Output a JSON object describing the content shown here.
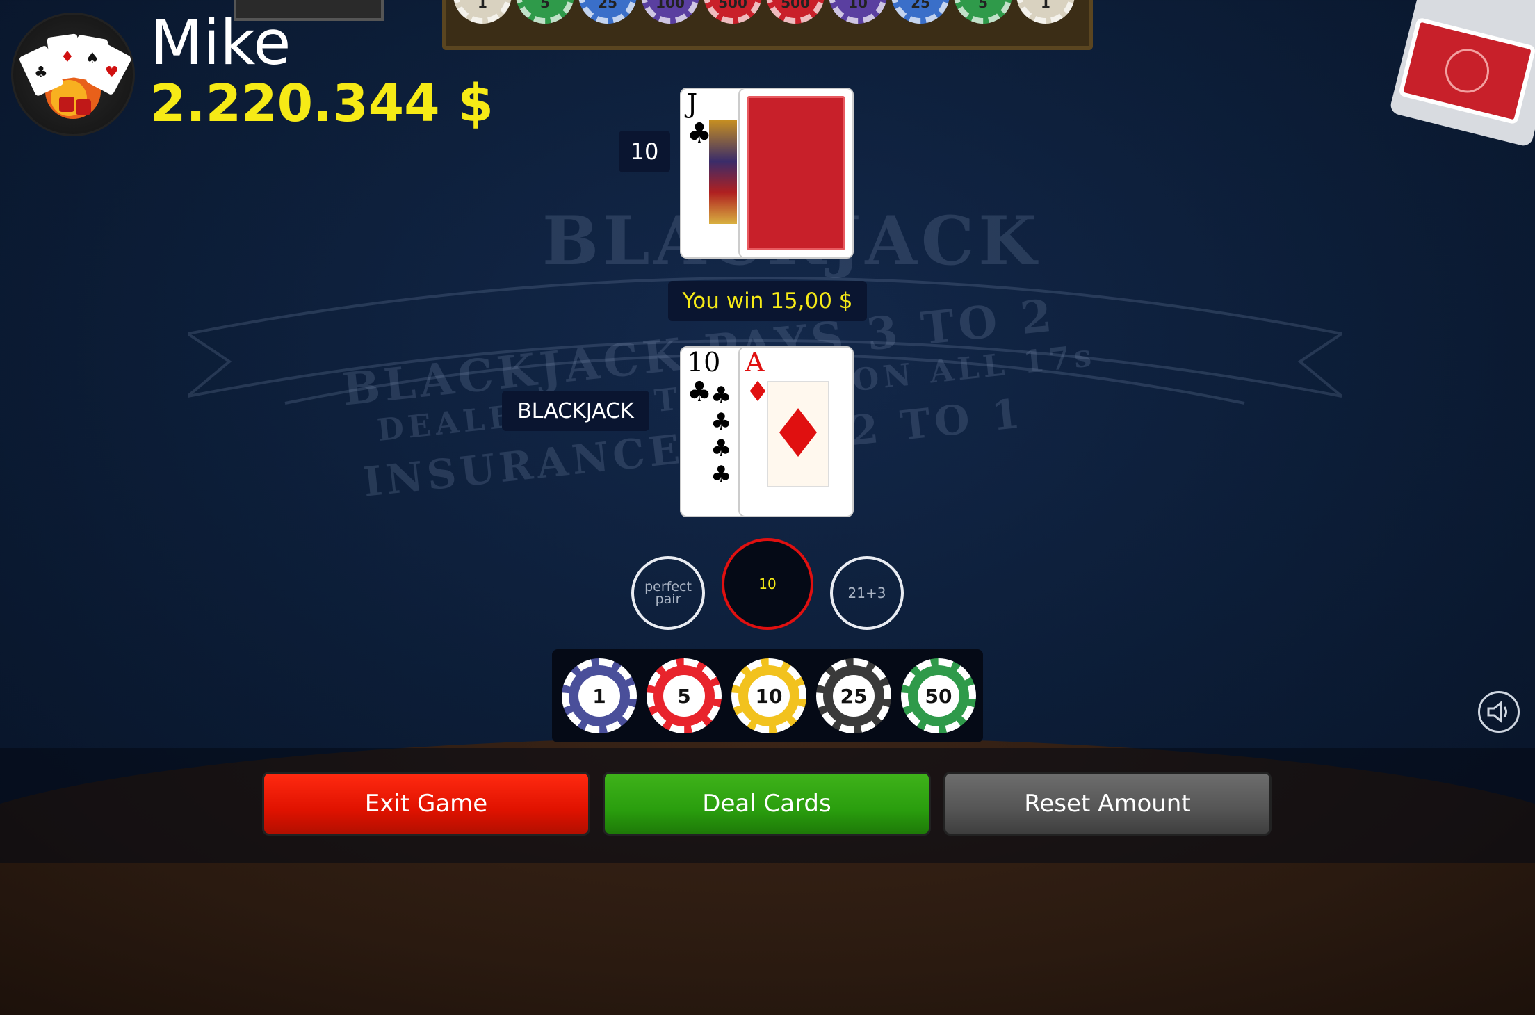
{
  "player": {
    "name": "Mike",
    "balance": "2.220.344 $"
  },
  "tray_chips": [
    "1",
    "5",
    "25",
    "100",
    "500",
    "500",
    "10",
    "25",
    "5",
    "1"
  ],
  "table_print": {
    "logo": "BLACKJACK",
    "line1": "BLACKJACK PAYS 3 TO 2",
    "line2": "DEALER MUST STAND ON ALL 17s",
    "line3": "INSURANCE PAYS 2 TO 1"
  },
  "dealer": {
    "score": "10",
    "cards": [
      {
        "rank": "J",
        "suit": "♣",
        "color": "#000000",
        "face_up": true
      },
      {
        "face_up": false
      }
    ]
  },
  "result_message": "You win 15,00 $",
  "player_hand": {
    "label": "BLACKJACK",
    "cards": [
      {
        "rank": "10",
        "suit": "♣",
        "color": "#000000"
      },
      {
        "rank": "A",
        "suit": "♦",
        "color": "#e01010"
      }
    ]
  },
  "bets": {
    "perfect_pair": "perfect pair",
    "main": "10",
    "side": "21+3"
  },
  "chips": [
    {
      "value": "1",
      "color": "#4a4f9a"
    },
    {
      "value": "5",
      "color": "#e8242c"
    },
    {
      "value": "10",
      "color": "#f2c21e"
    },
    {
      "value": "25",
      "color": "#3a3a3a"
    },
    {
      "value": "50",
      "color": "#2f9a4a"
    }
  ],
  "buttons": {
    "exit": "Exit Game",
    "deal": "Deal Cards",
    "reset": "Reset Amount"
  },
  "colors": {
    "balance": "#f6ea16",
    "win_text": "#f6ea16",
    "exit": "#e01200",
    "deal": "#2a9e0e",
    "reset": "#555555"
  }
}
